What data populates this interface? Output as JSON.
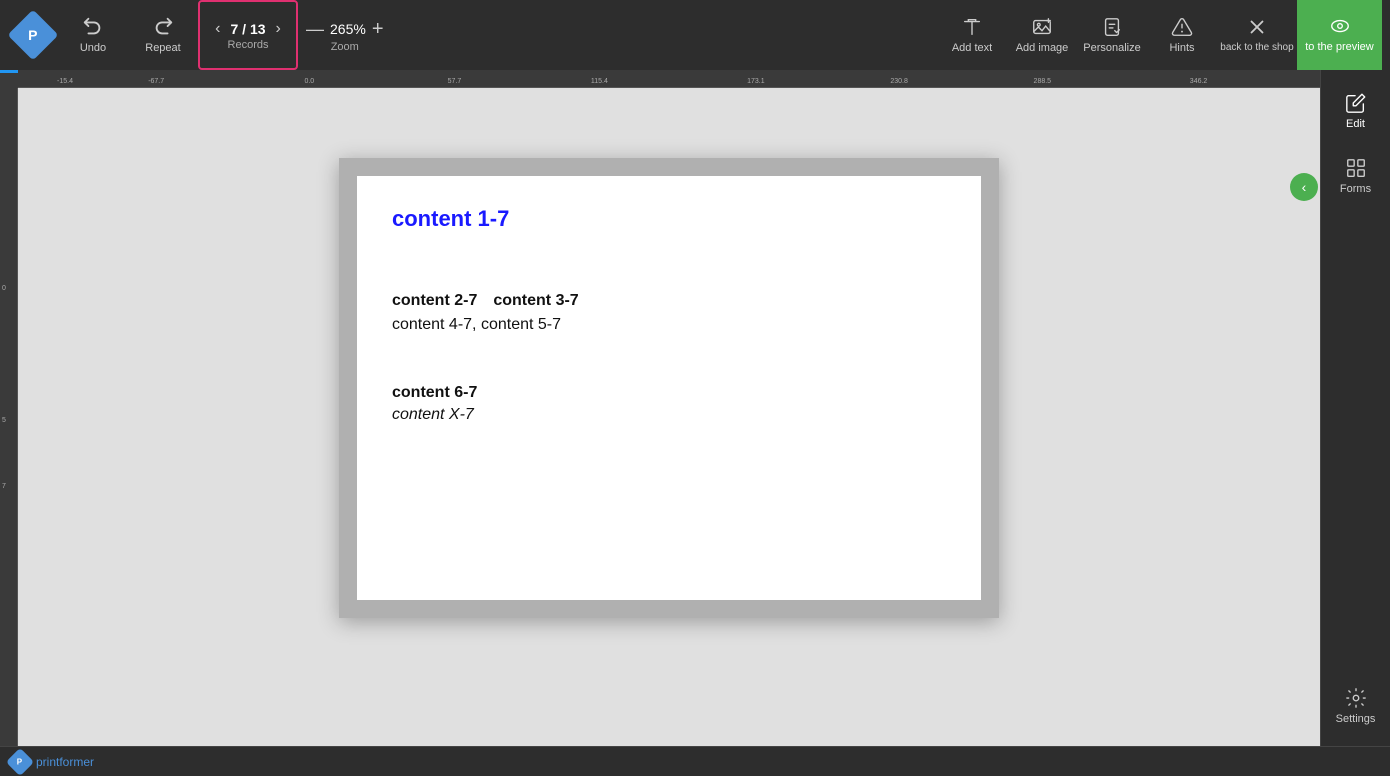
{
  "toolbar": {
    "undo_label": "Undo",
    "repeat_label": "Repeat",
    "records_label": "Records",
    "records_current": "7",
    "records_total": "13",
    "records_display": "7 / 13",
    "zoom_value": "265%",
    "zoom_label": "Zoom",
    "add_text_label": "Add text",
    "add_image_label": "Add image",
    "personalize_label": "Personalize",
    "hints_label": "Hints",
    "back_to_shop_label": "back to the shop",
    "to_preview_label": "to the preview"
  },
  "canvas": {
    "content_1_7": "content 1-7",
    "content_2_7": "content 2-7",
    "content_3_7": "content 3-7",
    "content_4_7": "content 4-7,",
    "content_5_7": "content 5-7",
    "content_6_7": "content 6-7",
    "content_x_7": "content X-7"
  },
  "right_panel": {
    "edit_label": "Edit",
    "forms_label": "Forms",
    "settings_label": "Settings"
  },
  "ruler": {
    "h_marks": [
      "-15.4",
      "-67.7",
      "0.0",
      "57.7",
      "115.4",
      "173.1",
      "230.8",
      "288.5",
      "346.2"
    ],
    "v_marks": [
      "0",
      "5",
      "7"
    ]
  },
  "bottom": {
    "logo_text": "printformer"
  }
}
